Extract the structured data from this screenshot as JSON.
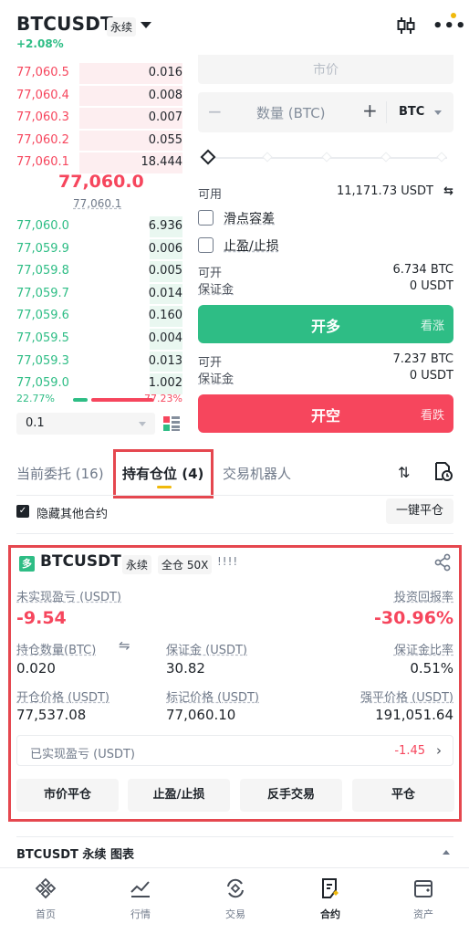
{
  "header": {
    "symbol": "BTCUSDT",
    "contract_tag": "永续",
    "change": "+2.08%",
    "icons": [
      "kline-icon",
      "more-icon"
    ]
  },
  "orderbook": {
    "asks": [
      {
        "price": "77,060.5",
        "qty": "0.016",
        "depth": 0.62
      },
      {
        "price": "77,060.4",
        "qty": "0.008",
        "depth": 0.62
      },
      {
        "price": "77,060.3",
        "qty": "0.007",
        "depth": 0.62
      },
      {
        "price": "77,060.2",
        "qty": "0.055",
        "depth": 0.62
      },
      {
        "price": "77,060.1",
        "qty": "18.444",
        "depth": 0.62
      }
    ],
    "last_price": "77,060.0",
    "mark_price": "77,060.1",
    "bids": [
      {
        "price": "77,060.0",
        "qty": "6.936",
        "depth": 0.2
      },
      {
        "price": "77,059.9",
        "qty": "0.006",
        "depth": 0.2
      },
      {
        "price": "77,059.8",
        "qty": "0.005",
        "depth": 0.2
      },
      {
        "price": "77,059.7",
        "qty": "0.014",
        "depth": 0.2
      },
      {
        "price": "77,059.6",
        "qty": "0.160",
        "depth": 0.2
      },
      {
        "price": "77,059.5",
        "qty": "0.004",
        "depth": 0.2
      },
      {
        "price": "77,059.3",
        "qty": "0.013",
        "depth": 0.2
      },
      {
        "price": "77,059.0",
        "qty": "1.002",
        "depth": 0.2
      }
    ],
    "buy_ratio": "22.77%",
    "sell_ratio": "77.23%",
    "depth_select": "0.1"
  },
  "form": {
    "price_placeholder": "市价",
    "qty_minus": "−",
    "qty_placeholder": "数量 (BTC)",
    "qty_plus": "+",
    "qty_unit": "BTC",
    "available_label": "可用",
    "available_value": "11,171.73 USDT",
    "slippage_label": "滑点容差",
    "tpsl_label": "止盈/止损",
    "long": {
      "open_label": "可开",
      "open_value": "6.734 BTC",
      "margin_label": "保证金",
      "margin_value": "0 USDT",
      "button": "开多",
      "sub": "看涨"
    },
    "short": {
      "open_label": "可开",
      "open_value": "7.237 BTC",
      "margin_label": "保证金",
      "margin_value": "0 USDT",
      "button": "开空",
      "sub": "看跌"
    }
  },
  "tabs": {
    "open_orders": "当前委托 (16)",
    "positions": "持有仓位 (4)",
    "bots": "交易机器人"
  },
  "list_controls": {
    "hide_others": "隐藏其他合约",
    "close_all": "一键平仓"
  },
  "position": {
    "side_tag": "多",
    "symbol": "BTCUSDT",
    "contract_tag": "永续",
    "margin_mode": "全仓 50X",
    "bars": "!!!!",
    "unrealized_label": "未实现盈亏 (USDT)",
    "unrealized_value": "-9.54",
    "roi_label": "投资回报率",
    "roi_value": "-30.96%",
    "size_label": "持仓数量(BTC)",
    "size_value": "0.020",
    "margin_label": "保证金 (USDT)",
    "margin_value": "30.82",
    "margin_ratio_label": "保证金比率",
    "margin_ratio_value": "0.51%",
    "entry_label": "开仓价格 (USDT)",
    "entry_value": "77,537.08",
    "mark_label": "标记价格 (USDT)",
    "mark_value": "77,060.10",
    "liq_label": "强平价格 (USDT)",
    "liq_value": "191,051.64",
    "realized_label": "已实现盈亏 (USDT)",
    "realized_value": "-1.45",
    "buttons": [
      "市价平仓",
      "止盈/止损",
      "反手交易",
      "平仓"
    ]
  },
  "chart_row": "BTCUSDT 永续 图表",
  "nav": [
    {
      "label": "首页",
      "icon": "home-icon"
    },
    {
      "label": "行情",
      "icon": "markets-icon"
    },
    {
      "label": "交易",
      "icon": "trade-icon"
    },
    {
      "label": "合约",
      "icon": "futures-icon"
    },
    {
      "label": "资产",
      "icon": "wallet-icon"
    }
  ],
  "colors": {
    "up": "#2ebd85",
    "down": "#f6465d",
    "accent": "#f0b90b",
    "highlight": "#e5474f"
  }
}
